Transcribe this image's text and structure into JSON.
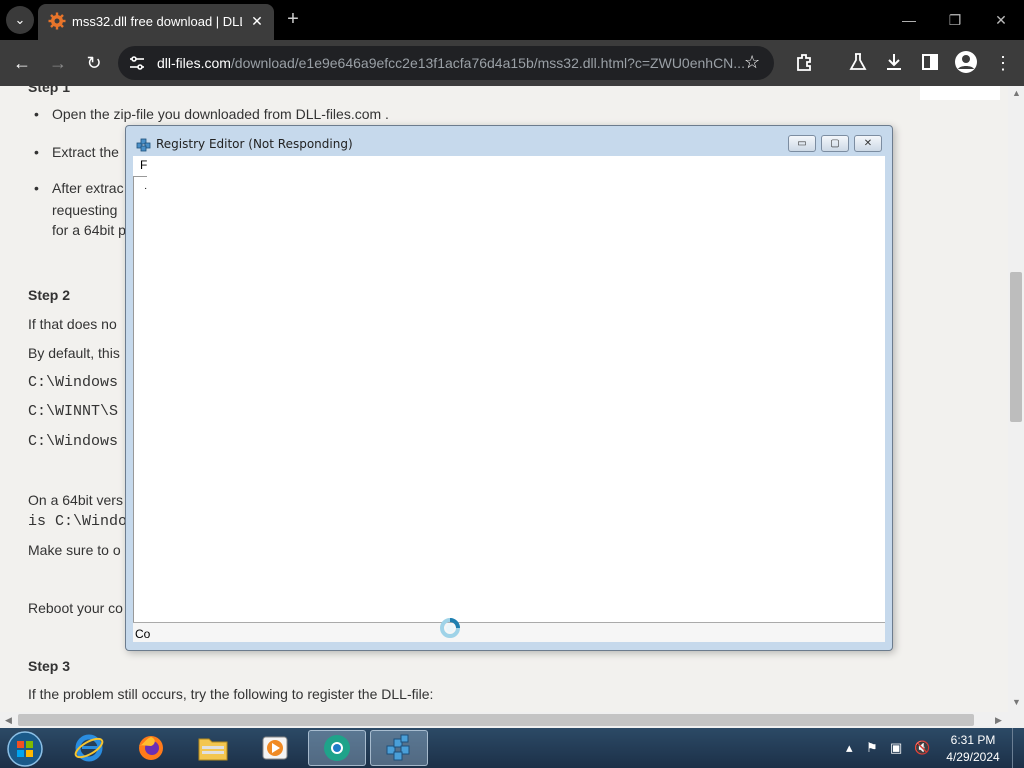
{
  "browser": {
    "tab": {
      "title": "mss32.dll free download | DLL",
      "close": "✕"
    },
    "new_tab": "+",
    "window_controls": {
      "minimize": "—",
      "restore": "❐",
      "close": "✕"
    },
    "url_host": "dll-files.com",
    "url_path": "/download/e1e9e646a9efcc2e13f1acfa76d4a15b/mss32.dll.html?c=ZWU0enhCN..."
  },
  "page": {
    "step1_heading": "Step 1",
    "step1_bullets": [
      "Open the zip-file you downloaded from DLL-files.com .",
      "Extract the",
      "After extrac",
      "requesting",
      "for a 64bit p"
    ],
    "step2_heading": "Step 2",
    "step2_lines": [
      "If that does no",
      "By default, this",
      "C:\\Windows",
      "C:\\WINNT\\S",
      "C:\\Windows",
      "On a 64bit vers",
      "is C:\\Window",
      "Make sure to o",
      "Reboot your co"
    ],
    "step3_heading": "Step 3",
    "step3_line": "If the problem still occurs, try the following to register the DLL-file:"
  },
  "regedit": {
    "title": "Registry Editor (Not Responding)",
    "menu_fragment": "F",
    "tree_fragment": "·",
    "status_fragment": "Co",
    "buttons": {
      "minimize": "▭",
      "maximize": "▢",
      "close": "✕"
    }
  },
  "taskbar": {
    "apps": [
      "internet-explorer",
      "firefox",
      "file-explorer",
      "media-player",
      "chrome",
      "registry-editor"
    ],
    "time": "6:31 PM",
    "date": "4/29/2024"
  }
}
